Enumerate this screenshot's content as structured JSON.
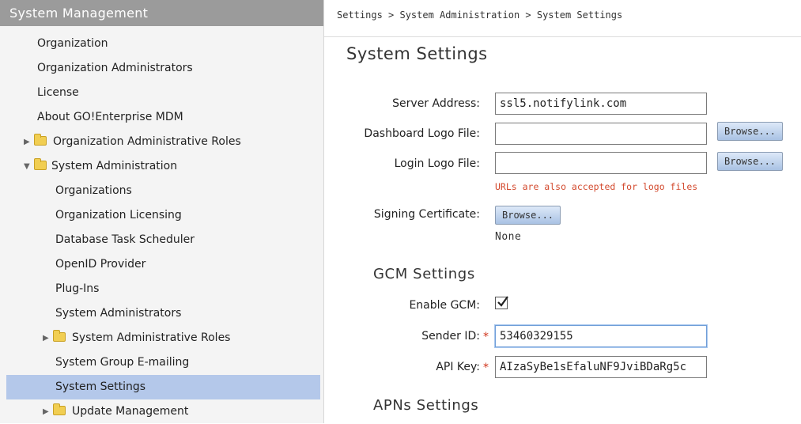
{
  "sidebar": {
    "header": "System Management",
    "items": [
      {
        "label": "Organization"
      },
      {
        "label": "Organization Administrators"
      },
      {
        "label": "License"
      },
      {
        "label": "About GO!Enterprise MDM"
      },
      {
        "label": "Organization Administrative Roles",
        "folder": true,
        "expanded": false
      },
      {
        "label": "System Administration",
        "folder": true,
        "expanded": true
      },
      {
        "label": "Organizations"
      },
      {
        "label": "Organization Licensing"
      },
      {
        "label": "Database Task Scheduler"
      },
      {
        "label": "OpenID Provider"
      },
      {
        "label": "Plug-Ins"
      },
      {
        "label": "System Administrators"
      },
      {
        "label": "System Administrative Roles",
        "folder": true,
        "expanded": false
      },
      {
        "label": "System Group E-mailing"
      },
      {
        "label": "System Settings",
        "selected": true
      },
      {
        "label": "Update Management",
        "folder": true,
        "expanded": false
      }
    ]
  },
  "breadcrumb": "Settings > System Administration > System Settings",
  "page_title": "System Settings",
  "form": {
    "server_address_label": "Server Address:",
    "server_address_value": "ssl5.notifylink.com",
    "dashboard_logo_label": "Dashboard Logo File:",
    "dashboard_logo_value": "",
    "login_logo_label": "Login Logo File:",
    "login_logo_value": "",
    "browse_label": "Browse...",
    "logo_hint": "URLs are also accepted for logo files",
    "signing_cert_label": "Signing Certificate:",
    "signing_cert_value": "None"
  },
  "gcm": {
    "title": "GCM Settings",
    "enable_label": "Enable GCM:",
    "enabled": true,
    "sender_id_label": "Sender ID:",
    "sender_id_value": "53460329155",
    "api_key_label": "API Key:",
    "api_key_value": "AIzaSyBe1sEfaluNF9JviBDaRg5c",
    "required_mark": "*"
  },
  "apns": {
    "title": "APNs Settings"
  },
  "colors": {
    "sidebar_header_bg": "#9b9b9b",
    "selected_bg": "#b4c8ea",
    "hint_red": "#d34a2e",
    "folder_yellow": "#f1ce52"
  }
}
